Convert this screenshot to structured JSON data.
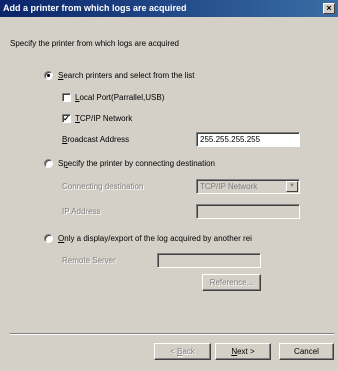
{
  "window": {
    "title": "Add a printer from which logs are acquired",
    "close_glyph": "×"
  },
  "instructions": "Specify the printer from which logs are acquired",
  "option_search": {
    "selected": true,
    "label_rest": "earch printers and select from the list",
    "accel": "S"
  },
  "local_port": {
    "checked": false,
    "accel": "L",
    "label_rest": "ocal Port(Parrallel,USB)"
  },
  "tcpip": {
    "checked": true,
    "accel": "T",
    "label_rest": "CP/IP Network",
    "check_glyph": "✓"
  },
  "broadcast": {
    "accel": "B",
    "label_rest": "roadcast Address",
    "value": "255.255.255.255"
  },
  "option_destination": {
    "selected": false,
    "label_pre": "S",
    "accel": "p",
    "label_rest": "ecify the printer by connecting destination"
  },
  "connecting_destination": {
    "label": "Connecting destination",
    "value": "TCP/IP Network",
    "arrow": "▼"
  },
  "ip_address": {
    "label": "IP Address",
    "value": ""
  },
  "option_export": {
    "selected": false,
    "accel": "O",
    "label_rest": "nly a display/export of the log acquired by another rei"
  },
  "remote_server": {
    "label": "Remote Server",
    "value": ""
  },
  "buttons": {
    "reference": "Reference...",
    "back_pre": "< ",
    "back_accel": "B",
    "back_rest": "ack",
    "next_accel": "N",
    "next_rest": "ext >",
    "cancel": "Cancel"
  }
}
